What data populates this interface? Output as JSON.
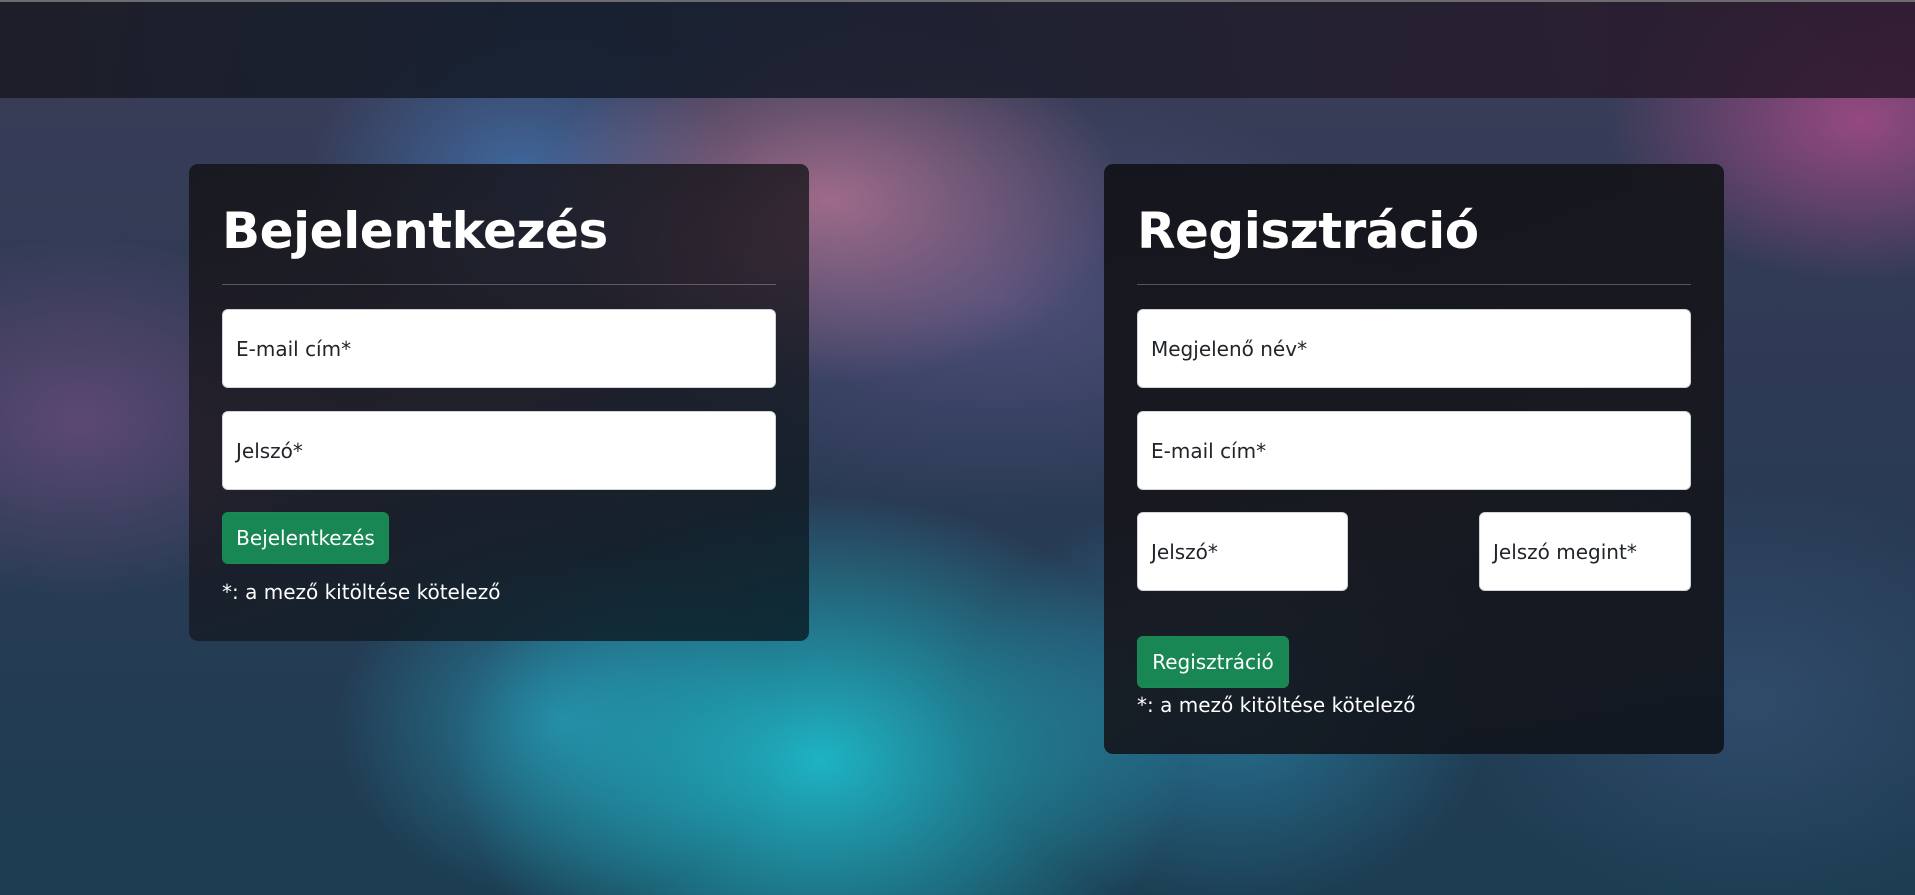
{
  "login": {
    "title": "Bejelentkezés",
    "email_placeholder": "E-mail cím*",
    "password_placeholder": "Jelszó*",
    "submit_label": "Bejelentkezés",
    "required_note": "*: a mező kitöltése kötelező"
  },
  "register": {
    "title": "Regisztráció",
    "display_name_placeholder": "Megjelenő név*",
    "email_placeholder": "E-mail cím*",
    "password_placeholder": "Jelszó*",
    "password_again_placeholder": "Jelszó megint*",
    "submit_label": "Regisztráció",
    "required_note": "*: a mező kitöltése kötelező"
  },
  "colors": {
    "button_green": "#198754",
    "card_background": "#16161c",
    "text_light": "#ffffff"
  }
}
